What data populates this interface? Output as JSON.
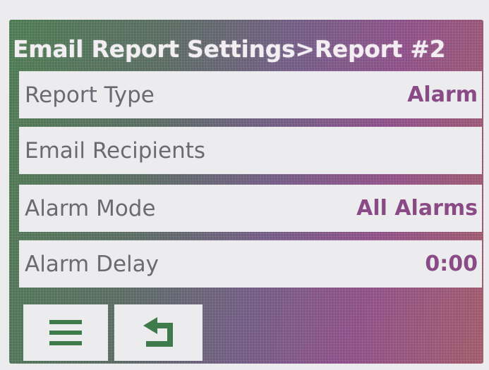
{
  "header": {
    "title": "Email Report Settings>Report #2"
  },
  "rows": [
    {
      "label": "Report Type",
      "value": "Alarm"
    },
    {
      "label": "Email Recipients",
      "value": ""
    },
    {
      "label": "Alarm Mode",
      "value": "All Alarms"
    },
    {
      "label": "Alarm Delay",
      "value": "0:00"
    }
  ],
  "footer": {
    "menu_icon": "hamburger-menu-icon",
    "back_icon": "return-arrow-icon"
  },
  "colors": {
    "accent": "#8a4a86",
    "label": "#6a6a72",
    "row_bg": "#ecebee",
    "title": "#f2eef2"
  }
}
